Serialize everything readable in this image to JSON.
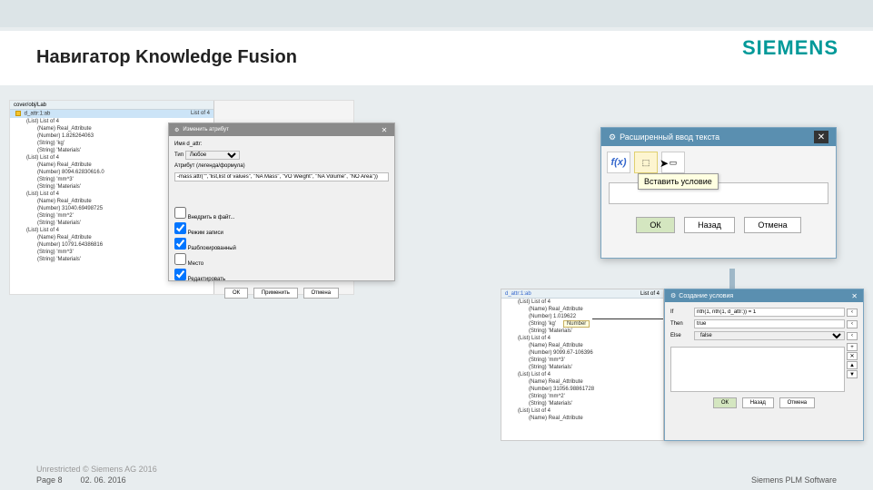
{
  "header": {
    "title": "Навигатор Knowledge Fusion",
    "brand": "SIEMENS"
  },
  "left_tree": {
    "header": "cover/obj/Lab",
    "col2": "List of 4",
    "root_sel": "d_attr:1:ab",
    "items": [
      {
        "lvl": 1,
        "label": "(List) List of 4"
      },
      {
        "lvl": 2,
        "label": "(Name) Real_Attribute"
      },
      {
        "lvl": 2,
        "label": "(Number) 1.826264063"
      },
      {
        "lvl": 2,
        "label": "(String) 'kg'"
      },
      {
        "lvl": 2,
        "label": "(String) 'Materials'"
      },
      {
        "lvl": 1,
        "label": "(List) List of 4"
      },
      {
        "lvl": 2,
        "label": "(Name) Real_Attribute"
      },
      {
        "lvl": 2,
        "label": "(Number) 8094.62830616.0"
      },
      {
        "lvl": 2,
        "label": "(String) 'mm^3'"
      },
      {
        "lvl": 2,
        "label": "(String) 'Materials'"
      },
      {
        "lvl": 1,
        "label": "(List) List of 4"
      },
      {
        "lvl": 2,
        "label": "(Name) Real_Attribute"
      },
      {
        "lvl": 2,
        "label": "(Number) 31040.69498725"
      },
      {
        "lvl": 2,
        "label": "(String) 'mm^2'"
      },
      {
        "lvl": 2,
        "label": "(String) 'Materials'"
      },
      {
        "lvl": 1,
        "label": "(List) List of 4"
      },
      {
        "lvl": 2,
        "label": "(Name) Real_Attribute"
      },
      {
        "lvl": 2,
        "label": "(Number) 10791.64386816"
      },
      {
        "lvl": 2,
        "label": "(String) 'mm^3'"
      },
      {
        "lvl": 2,
        "label": "(String) 'Materials'"
      }
    ]
  },
  "dialog1": {
    "title": "Изменить атрибут",
    "name_label": "Имя",
    "name_value": "d_attr:",
    "type_label": "Тип",
    "type_value": "Любое",
    "source_label": "Атрибут (легенда/формула)",
    "formula": "-mass:attr(\"\",\"list,list of values\", \"NA Mass\", \"VO Weight\", \"NA Volume\", \"NO Area\"))",
    "cbx1": "Внедрить в файт...",
    "cbx2": "Режим записи",
    "cbx3": "Разблокированный",
    "cbx4": "Место",
    "cbx5": "Редактировать",
    "btn_ok": "ОК",
    "btn_apply": "Применить",
    "btn_cancel": "Отмена"
  },
  "dialog2": {
    "title": "Расширенный ввод текста",
    "tooltip": "Вставить условие",
    "btn_ok": "ОК",
    "btn_back": "Назад",
    "btn_cancel": "Отмена"
  },
  "br_tree": {
    "header": "d_attr:1:ab",
    "col2": "List of 4",
    "items": [
      {
        "lvl": 1,
        "label": "(List) List of 4"
      },
      {
        "lvl": 2,
        "label": "(Name) Real_Attribute"
      },
      {
        "lvl": 2,
        "label": "(Number) 1.019622"
      },
      {
        "lvl": 2,
        "label": "(String) 'kg'",
        "hint": "Number"
      },
      {
        "lvl": 2,
        "label": "(String) 'Materials'"
      },
      {
        "lvl": 1,
        "label": "(List) List of 4"
      },
      {
        "lvl": 2,
        "label": "(Name) Real_Attribute"
      },
      {
        "lvl": 2,
        "label": "(Number) 9099.67-106396"
      },
      {
        "lvl": 2,
        "label": "(String) 'mm^3'"
      },
      {
        "lvl": 2,
        "label": "(String) 'Materials'"
      },
      {
        "lvl": 1,
        "label": "(List) List of 4"
      },
      {
        "lvl": 2,
        "label": "(Name) Real_Attribute"
      },
      {
        "lvl": 2,
        "label": "(Number) 31056.98861728"
      },
      {
        "lvl": 2,
        "label": "(String) 'mm^2'"
      },
      {
        "lvl": 2,
        "label": "(String) 'Materials'"
      },
      {
        "lvl": 1,
        "label": "(List) List of 4"
      },
      {
        "lvl": 2,
        "label": "(Name) Real_Attribute"
      }
    ]
  },
  "dialog3": {
    "title": "Создание условия",
    "if_label": "If",
    "if_value": "nth(1, nth(1, d_attr:)) = 1",
    "then_label": "Then",
    "then_value": "true",
    "else_label": "Else",
    "else_value": "false",
    "btn_ok": "ОК",
    "btn_back": "Назад",
    "btn_cancel": "Отмена"
  },
  "footer": {
    "copy": "Unrestricted © Siemens AG 2016",
    "page": "Page 8",
    "date": "02. 06. 2016",
    "right": "Siemens PLM Software"
  }
}
